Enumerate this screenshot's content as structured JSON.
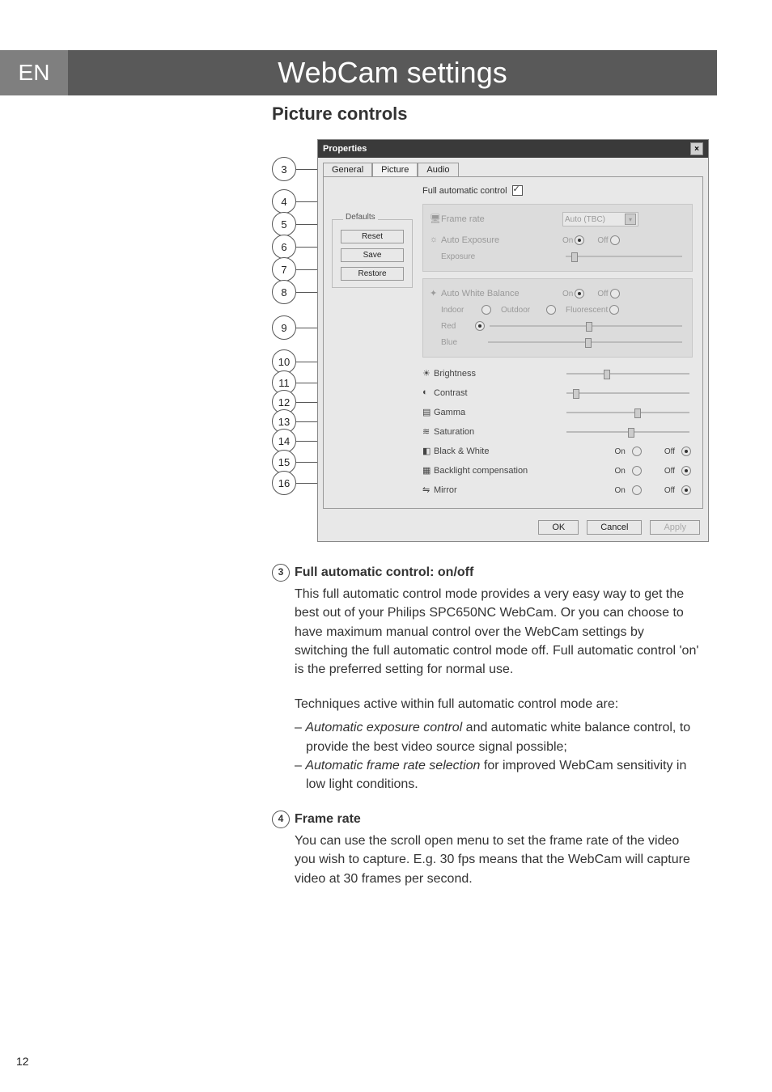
{
  "page_number": "12",
  "lang_tab": "EN",
  "title": "WebCam settings",
  "section_title": "Picture controls",
  "callouts": [
    "3",
    "4",
    "5",
    "6",
    "7",
    "8",
    "9",
    "10",
    "11",
    "12",
    "13",
    "14",
    "15",
    "16"
  ],
  "dialog": {
    "title": "Properties",
    "tabs": {
      "general": "General",
      "picture": "Picture",
      "audio": "Audio"
    },
    "full_auto_label": "Full automatic control",
    "defaults": {
      "legend": "Defaults",
      "reset": "Reset",
      "save": "Save",
      "restore": "Restore"
    },
    "frame_rate": {
      "label": "Frame rate",
      "value": "Auto (TBC)"
    },
    "auto_exposure": {
      "label": "Auto Exposure",
      "on": "On",
      "off": "Off"
    },
    "exposure": {
      "label": "Exposure"
    },
    "awb": {
      "label": "Auto White Balance",
      "on": "On",
      "off": "Off",
      "indoor": "Indoor",
      "outdoor": "Outdoor",
      "fluorescent": "Fluorescent",
      "red": "Red",
      "blue": "Blue"
    },
    "brightness": "Brightness",
    "contrast": "Contrast",
    "gamma": "Gamma",
    "saturation": "Saturation",
    "bw": {
      "label": "Black & White",
      "on": "On",
      "off": "Off"
    },
    "backlight": {
      "label": "Backlight compensation",
      "on": "On",
      "off": "Off"
    },
    "mirror": {
      "label": "Mirror",
      "on": "On",
      "off": "Off"
    },
    "buttons": {
      "ok": "OK",
      "cancel": "Cancel",
      "apply": "Apply"
    }
  },
  "text": {
    "item3_head": "Full automatic control: on/off",
    "item3_body": "This full automatic control mode provides a very easy way to get the best out of your Philips SPC650NC WebCam. Or you can choose to have maximum manual control over the WebCam settings by switching the full automatic control mode off. Full automatic control 'on' is the preferred setting for normal use.",
    "item3_techs_intro": "Techniques active within full automatic control mode are:",
    "item3_tech1a": "Automatic exposure control",
    "item3_tech1b": " and automatic white balance control, to provide the best video source signal possible;",
    "item3_tech2a": "Automatic frame rate selection",
    "item3_tech2b": " for improved WebCam sensitivity in low light conditions.",
    "item4_head": "Frame rate",
    "item4_body": "You can use the scroll open menu to set the frame rate of the video you wish to capture. E.g. 30 fps means that the WebCam will capture video at 30 frames per second."
  }
}
